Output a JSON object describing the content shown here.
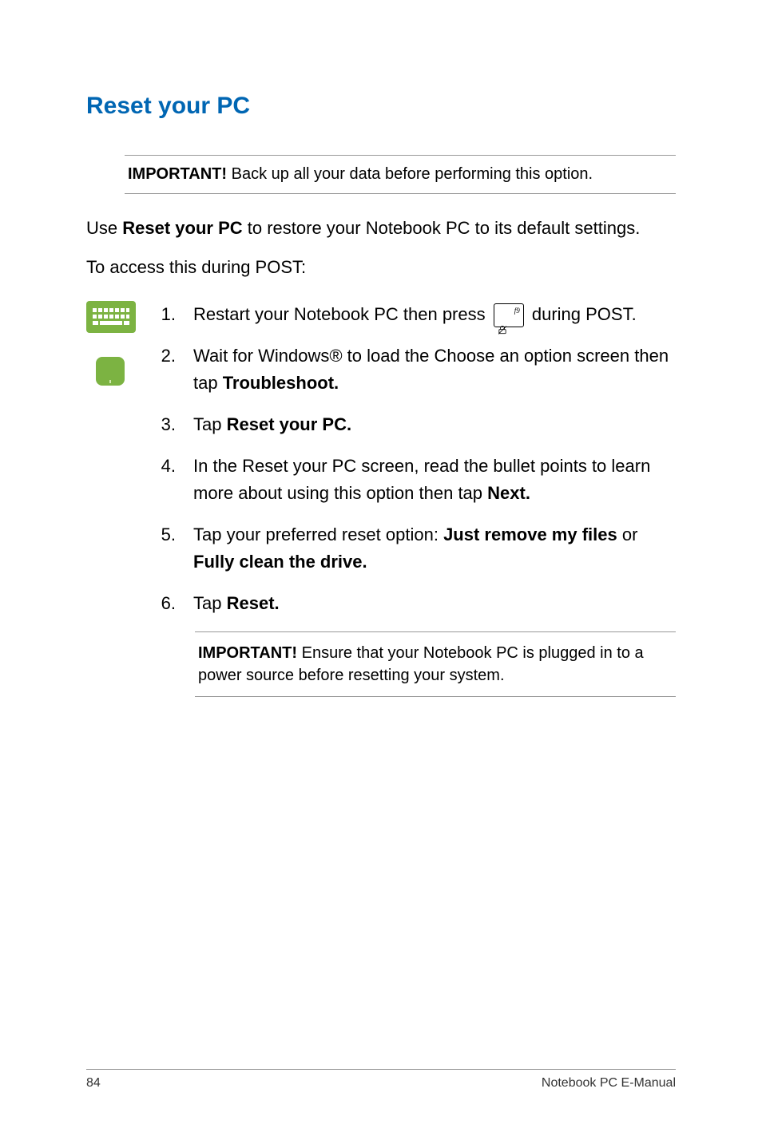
{
  "heading": "Reset your PC",
  "callout1": {
    "label": "IMPORTANT!",
    "text": " Back up all your data before performing this option."
  },
  "intro": {
    "pre": "Use ",
    "bold": "Reset your PC",
    "post": " to restore your Notebook PC to its default settings."
  },
  "lead": "To access this during POST:",
  "steps": {
    "s1": {
      "pre": "Restart your Notebook PC then press ",
      "post": " during POST.",
      "keyLabel": "f9"
    },
    "s2": {
      "pre": "Wait for Windows® to load the Choose an option screen then tap ",
      "bold": "Troubleshoot."
    },
    "s3": {
      "pre": "Tap ",
      "bold": "Reset your PC."
    },
    "s4": {
      "pre": "In the Reset your PC screen, read the bullet points to learn more about using this option then tap ",
      "bold": "Next."
    },
    "s5": {
      "pre": "Tap your preferred reset option: ",
      "bold1": "Just remove my files",
      "mid": " or ",
      "bold2": "Fully clean the drive."
    },
    "s6": {
      "pre": "Tap ",
      "bold": "Reset."
    }
  },
  "callout2": {
    "label": "IMPORTANT!",
    "text": " Ensure that your Notebook PC is plugged in to a power source before resetting your system."
  },
  "footer": {
    "page": "84",
    "title": "Notebook PC E-Manual"
  }
}
